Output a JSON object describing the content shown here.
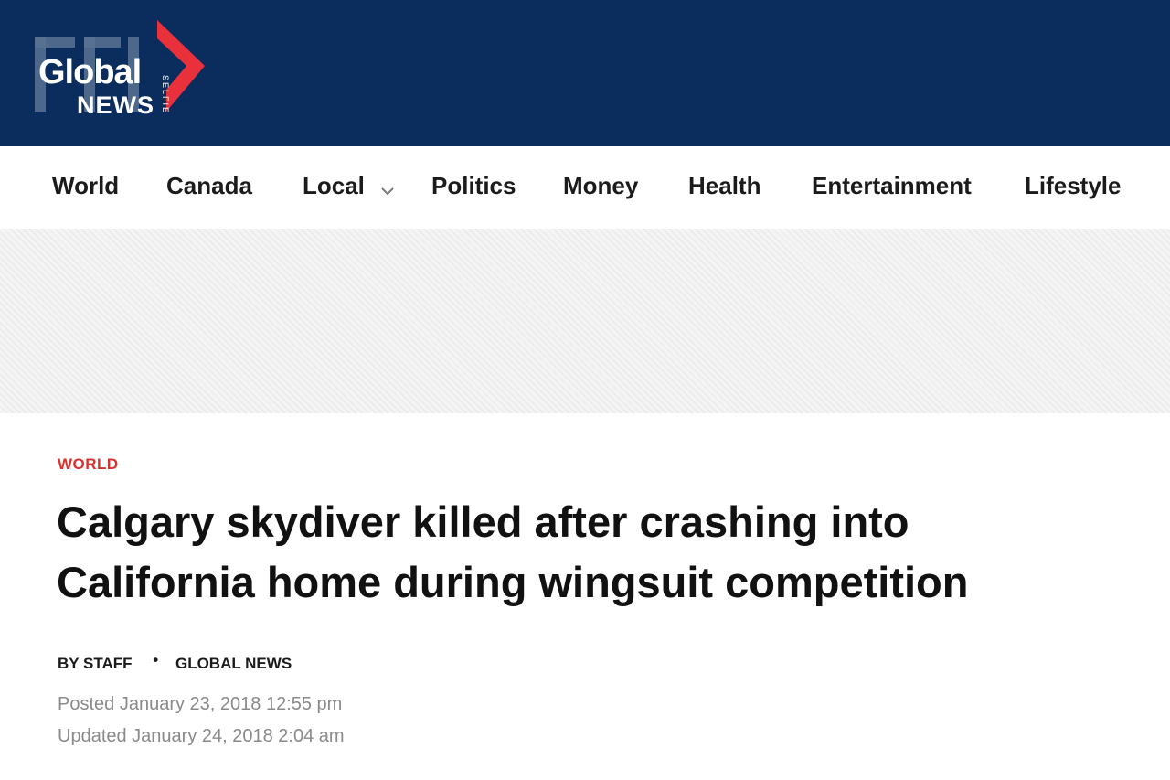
{
  "header": {
    "logo": {
      "global": "Global",
      "news": "NEWS",
      "selfie": "SELFIE"
    },
    "background_color": "#0a2d5e",
    "accent_color": "#d8322f"
  },
  "nav": {
    "items": [
      {
        "label": "World"
      },
      {
        "label": "Canada"
      },
      {
        "label": "Local",
        "has_dropdown": true,
        "icon": "chevron-down-icon"
      },
      {
        "label": "Politics"
      },
      {
        "label": "Money"
      },
      {
        "label": "Health"
      },
      {
        "label": "Entertainment"
      },
      {
        "label": "Lifestyle"
      }
    ]
  },
  "article": {
    "category": "WORLD",
    "headline_line1": "Calgary skydiver killed after crashing into",
    "headline_line2": "California home during wingsuit competition",
    "byline": {
      "author": "BY STAFF",
      "separator": "•",
      "outlet": "GLOBAL NEWS"
    },
    "posted": "Posted January 23, 2018 12:55 pm",
    "updated": "Updated January 24, 2018 2:04 am"
  }
}
